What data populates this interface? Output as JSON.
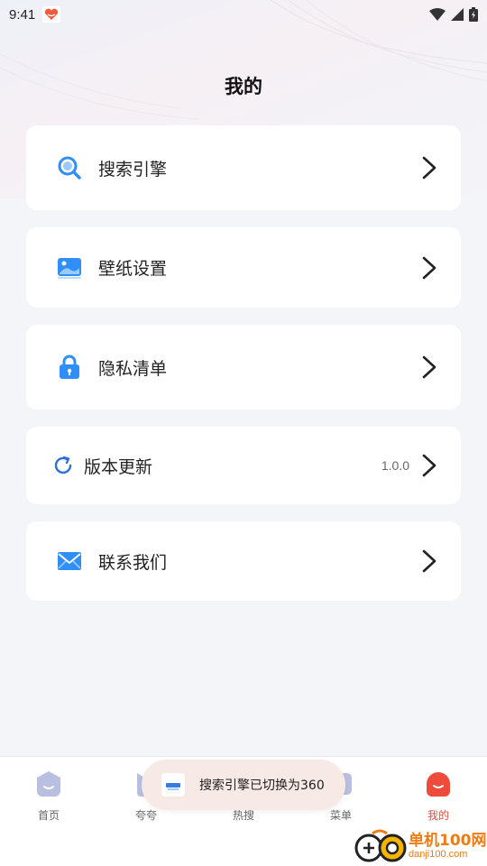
{
  "status": {
    "time": "9:41",
    "colors": {
      "app_icon": "#f25a3c"
    }
  },
  "page": {
    "title": "我的"
  },
  "menu": [
    {
      "label": "搜索引擎",
      "icon": "search-icon"
    },
    {
      "label": "壁纸设置",
      "icon": "wallpaper-icon"
    },
    {
      "label": "隐私清单",
      "icon": "lock-icon"
    },
    {
      "label": "版本更新",
      "icon": "refresh-icon",
      "value": "1.0.0"
    },
    {
      "label": "联系我们",
      "icon": "mail-icon"
    }
  ],
  "tabs": [
    {
      "label": "首页",
      "icon": "home-icon"
    },
    {
      "label": "夸夸",
      "icon": "praise-icon"
    },
    {
      "label": "热搜",
      "icon": "trending-icon"
    },
    {
      "label": "菜单",
      "icon": "menu-icon"
    },
    {
      "label": "我的",
      "icon": "profile-icon",
      "active": true
    }
  ],
  "toast": {
    "message": "搜索引擎已切换为360"
  },
  "watermark": {
    "name": "单机100网",
    "url": "danji100.com"
  },
  "colors": {
    "accent_blue": "#2f8ff7",
    "active_tab": "#ee4b3b",
    "background": "#f4f5f8",
    "watermark": "#f07b12"
  }
}
